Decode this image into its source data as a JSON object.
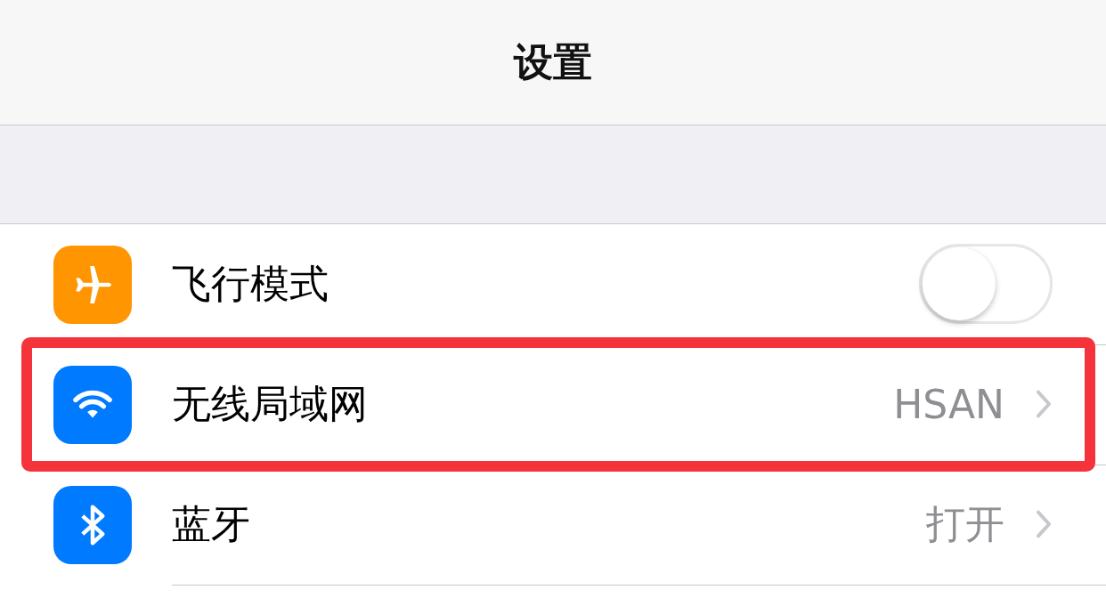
{
  "nav_bar": {
    "title": "设置"
  },
  "rows": [
    {
      "kind": "toggle",
      "color": "#ff9500",
      "label": "飞行模式",
      "on": false,
      "highlighted": false
    },
    {
      "kind": "link",
      "color": "#007aff",
      "label": "无线局域网",
      "value": "HSAN",
      "highlighted": true
    },
    {
      "kind": "link",
      "color": "#007aff",
      "label": "蓝牙",
      "value": "打开",
      "highlighted": false
    }
  ]
}
